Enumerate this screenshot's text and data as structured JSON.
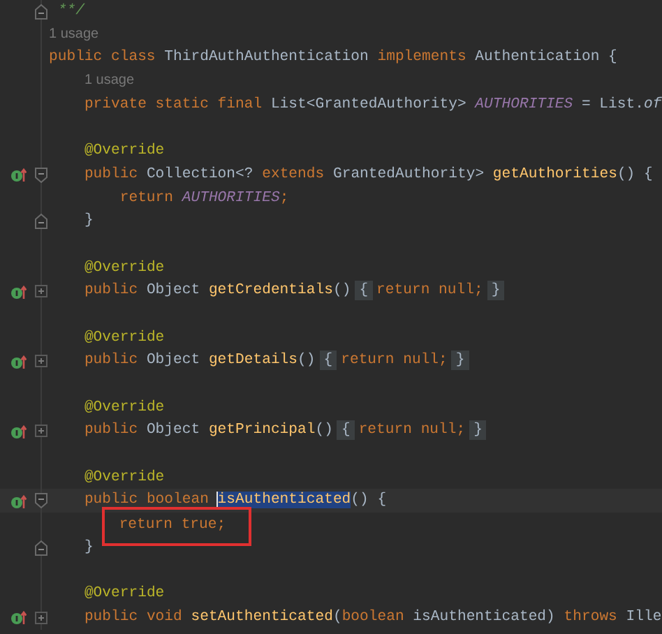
{
  "editor": {
    "lines": [
      {
        "override": false,
        "current": false,
        "fold": {
          "kind": "end"
        },
        "tokens": [
          {
            "text": " **/",
            "kind": "comment"
          }
        ]
      },
      {
        "override": false,
        "current": false,
        "tokens": [
          {
            "text": "1 usage",
            "kind": "hint"
          }
        ]
      },
      {
        "override": false,
        "current": false,
        "tokens": [
          {
            "text": "public class",
            "kind": "keyword"
          },
          {
            "text": " ThirdAuthAuthentication ",
            "kind": "plain"
          },
          {
            "text": "implements",
            "kind": "keyword"
          },
          {
            "text": " Authentication {",
            "kind": "plain"
          }
        ]
      },
      {
        "override": false,
        "current": false,
        "tokens": [
          {
            "text": "1 usage",
            "kind": "hint"
          }
        ]
      },
      {
        "override": false,
        "current": false,
        "tokens": [
          {
            "text": "    private static final",
            "kind": "keyword"
          },
          {
            "text": " List<GrantedAuthority> ",
            "kind": "plain"
          },
          {
            "text": "AUTHORITIES",
            "kind": "constant"
          },
          {
            "text": " = List.",
            "kind": "plain"
          },
          {
            "text": "of",
            "kind": "static"
          }
        ]
      },
      {
        "override": false,
        "current": false
      },
      {
        "override": false,
        "current": false,
        "tokens": [
          {
            "text": "    @Override",
            "kind": "annotation"
          }
        ]
      },
      {
        "override": true,
        "current": false,
        "fold": {
          "kind": "start"
        },
        "tokens": [
          {
            "text": "    public",
            "kind": "keyword"
          },
          {
            "text": " Collection<? ",
            "kind": "plain"
          },
          {
            "text": "extends",
            "kind": "keyword"
          },
          {
            "text": " GrantedAuthority> ",
            "kind": "plain"
          },
          {
            "text": "getAuthorities",
            "kind": "method"
          },
          {
            "text": "() {",
            "kind": "plain"
          }
        ]
      },
      {
        "override": false,
        "current": false,
        "tokens": [
          {
            "text": "        return",
            "kind": "keyword"
          },
          {
            "text": " AUTHORITIES",
            "kind": "constant"
          },
          {
            "text": ";",
            "kind": "keyword"
          }
        ]
      },
      {
        "override": false,
        "current": false,
        "fold": {
          "kind": "end"
        },
        "tokens": [
          {
            "text": "    }",
            "kind": "plain"
          }
        ]
      },
      {
        "override": false,
        "current": false
      },
      {
        "override": false,
        "current": false,
        "tokens": [
          {
            "text": "    @Override",
            "kind": "annotation"
          }
        ]
      },
      {
        "override": true,
        "current": false,
        "fold": {
          "kind": "collapsed"
        },
        "tokens": [
          {
            "text": "    public",
            "kind": "keyword"
          },
          {
            "text": " Object ",
            "kind": "plain"
          },
          {
            "text": "getCredentials",
            "kind": "method"
          },
          {
            "text": "()",
            "kind": "plain"
          },
          {
            "text": "{",
            "kind": "fold"
          },
          {
            "text": "return null;",
            "kind": "keyword"
          },
          {
            "text": "}",
            "kind": "fold"
          }
        ]
      },
      {
        "override": false,
        "current": false
      },
      {
        "override": false,
        "current": false,
        "tokens": [
          {
            "text": "    @Override",
            "kind": "annotation"
          }
        ]
      },
      {
        "override": true,
        "current": false,
        "fold": {
          "kind": "collapsed"
        },
        "tokens": [
          {
            "text": "    public",
            "kind": "keyword"
          },
          {
            "text": " Object ",
            "kind": "plain"
          },
          {
            "text": "getDetails",
            "kind": "method"
          },
          {
            "text": "()",
            "kind": "plain"
          },
          {
            "text": "{",
            "kind": "fold"
          },
          {
            "text": "return null;",
            "kind": "keyword"
          },
          {
            "text": "}",
            "kind": "fold"
          }
        ]
      },
      {
        "override": false,
        "current": false
      },
      {
        "override": false,
        "current": false,
        "tokens": [
          {
            "text": "    @Override",
            "kind": "annotation"
          }
        ]
      },
      {
        "override": true,
        "current": false,
        "fold": {
          "kind": "collapsed"
        },
        "tokens": [
          {
            "text": "    public",
            "kind": "keyword"
          },
          {
            "text": " Object ",
            "kind": "plain"
          },
          {
            "text": "getPrincipal",
            "kind": "method"
          },
          {
            "text": "()",
            "kind": "plain"
          },
          {
            "text": "{",
            "kind": "fold"
          },
          {
            "text": "return null;",
            "kind": "keyword"
          },
          {
            "text": "}",
            "kind": "fold"
          }
        ]
      },
      {
        "override": false,
        "current": false
      },
      {
        "override": false,
        "current": false,
        "tokens": [
          {
            "text": "    @Override",
            "kind": "annotation"
          }
        ]
      },
      {
        "override": true,
        "current": true,
        "fold": {
          "kind": "start"
        },
        "tokens": [
          {
            "text": "    public boolean ",
            "kind": "keyword",
            "selected": false
          },
          {
            "text": "isAuthenticated",
            "kind": "method",
            "selected": true
          },
          {
            "text": "() {",
            "kind": "plain",
            "selected": false
          }
        ]
      },
      {
        "override": false,
        "current": false,
        "boxed": true,
        "tokens": [
          {
            "text": "        return true;",
            "kind": "keyword"
          }
        ]
      },
      {
        "override": false,
        "current": false,
        "fold": {
          "kind": "end"
        },
        "tokens": [
          {
            "text": "    }",
            "kind": "plain"
          }
        ]
      },
      {
        "override": false,
        "current": false
      },
      {
        "override": false,
        "current": false,
        "tokens": [
          {
            "text": "    @Override",
            "kind": "annotation"
          }
        ]
      },
      {
        "override": true,
        "current": false,
        "fold": {
          "kind": "collapsed"
        },
        "tokens": [
          {
            "text": "    public void ",
            "kind": "keyword"
          },
          {
            "text": "setAuthenticated",
            "kind": "method"
          },
          {
            "text": "(",
            "kind": "plain"
          },
          {
            "text": "boolean",
            "kind": "keyword"
          },
          {
            "text": " isAuthenticated) ",
            "kind": "plain"
          },
          {
            "text": "throws",
            "kind": "keyword"
          },
          {
            "text": " Ille",
            "kind": "plain"
          }
        ]
      }
    ]
  }
}
